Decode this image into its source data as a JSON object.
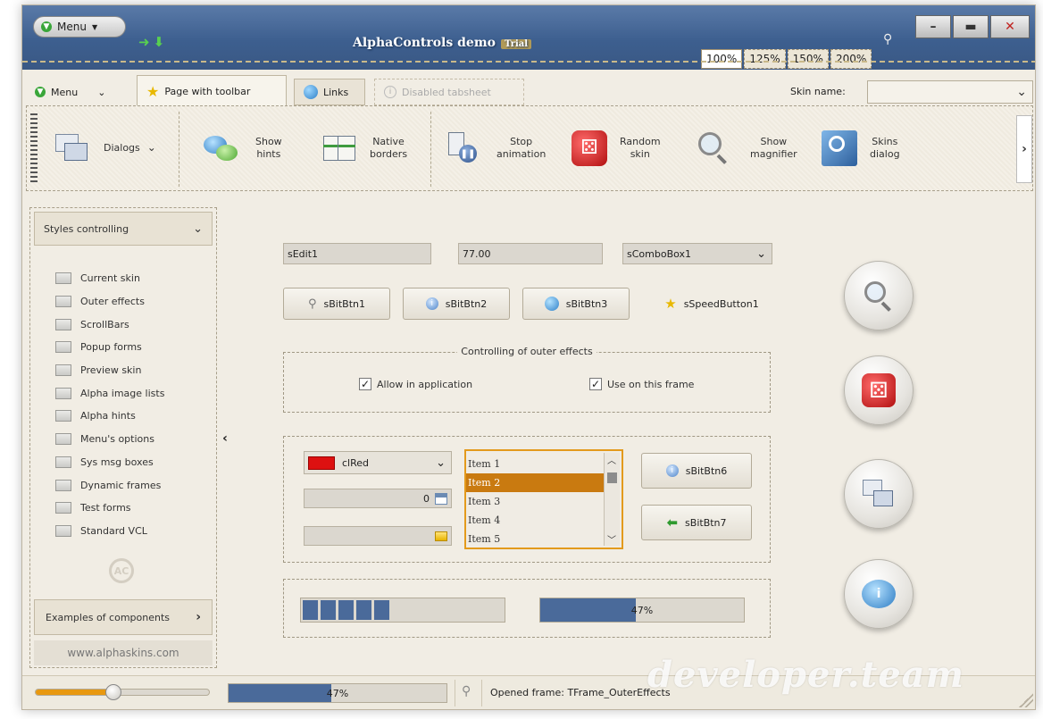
{
  "window": {
    "title": "AlphaControls demo",
    "title_badge": "Trial",
    "menu_label": "Menu",
    "zoom_tabs": [
      "100%",
      "125%",
      "150%",
      "200%"
    ]
  },
  "tabs": {
    "menu_label": "Menu",
    "page_toolbar": "Page with toolbar",
    "links": "Links",
    "disabled": "Disabled tabsheet",
    "skin_label": "Skin name:",
    "skin_value": ""
  },
  "toolbar": {
    "dialogs": "Dialogs",
    "show_hints_1": "Show",
    "show_hints_2": "hints",
    "native_1": "Native",
    "native_2": "borders",
    "stop_1": "Stop",
    "stop_2": "animation",
    "random_1": "Random",
    "random_2": "skin",
    "magnifier_1": "Show",
    "magnifier_2": "magnifier",
    "skins_1": "Skins",
    "skins_2": "dialog"
  },
  "sidebar": {
    "header": "Styles controlling",
    "items": [
      "Current skin",
      "Outer effects",
      "ScrollBars",
      "Popup forms",
      "Preview skin",
      "Alpha image lists",
      "Alpha hints",
      "Menu's options",
      "Sys msg boxes",
      "Dynamic frames",
      "Test forms",
      "Standard VCL"
    ],
    "examples": "Examples of components",
    "url": "www.alphaskins.com"
  },
  "frame": {
    "edit1": "sEdit1",
    "edit2": "77.00",
    "combo1": "sComboBox1",
    "btn1": "sBitBtn1",
    "btn2": "sBitBtn2",
    "btn3": "sBitBtn3",
    "speed1": "sSpeedButton1",
    "group_title": "Controlling of outer effects",
    "chk_app": "Allow in application",
    "chk_frame": "Use on this frame",
    "color_combo": "clRed",
    "spin_value": "0",
    "list_items": [
      "Item 1",
      "Item 2",
      "Item 3",
      "Item 4",
      "Item 5"
    ],
    "list_selected": 1,
    "btn6": "sBitBtn6",
    "btn7": "sBitBtn7",
    "progress_segments": 5,
    "progress_value_text": "47%",
    "progress_value": 0.47
  },
  "status": {
    "slider_value": 0.45,
    "progress_text": "47%",
    "progress_value": 0.47,
    "message": "Opened frame: TFrame_OuterEffects"
  },
  "watermark": "developer.team",
  "colors": {
    "title_blue": "#3d5f8f",
    "accent_orange": "#c97a10",
    "progress_blue": "#4a6a9a",
    "selection_orange": "#c97a10",
    "red_swatch": "#dd1111"
  }
}
